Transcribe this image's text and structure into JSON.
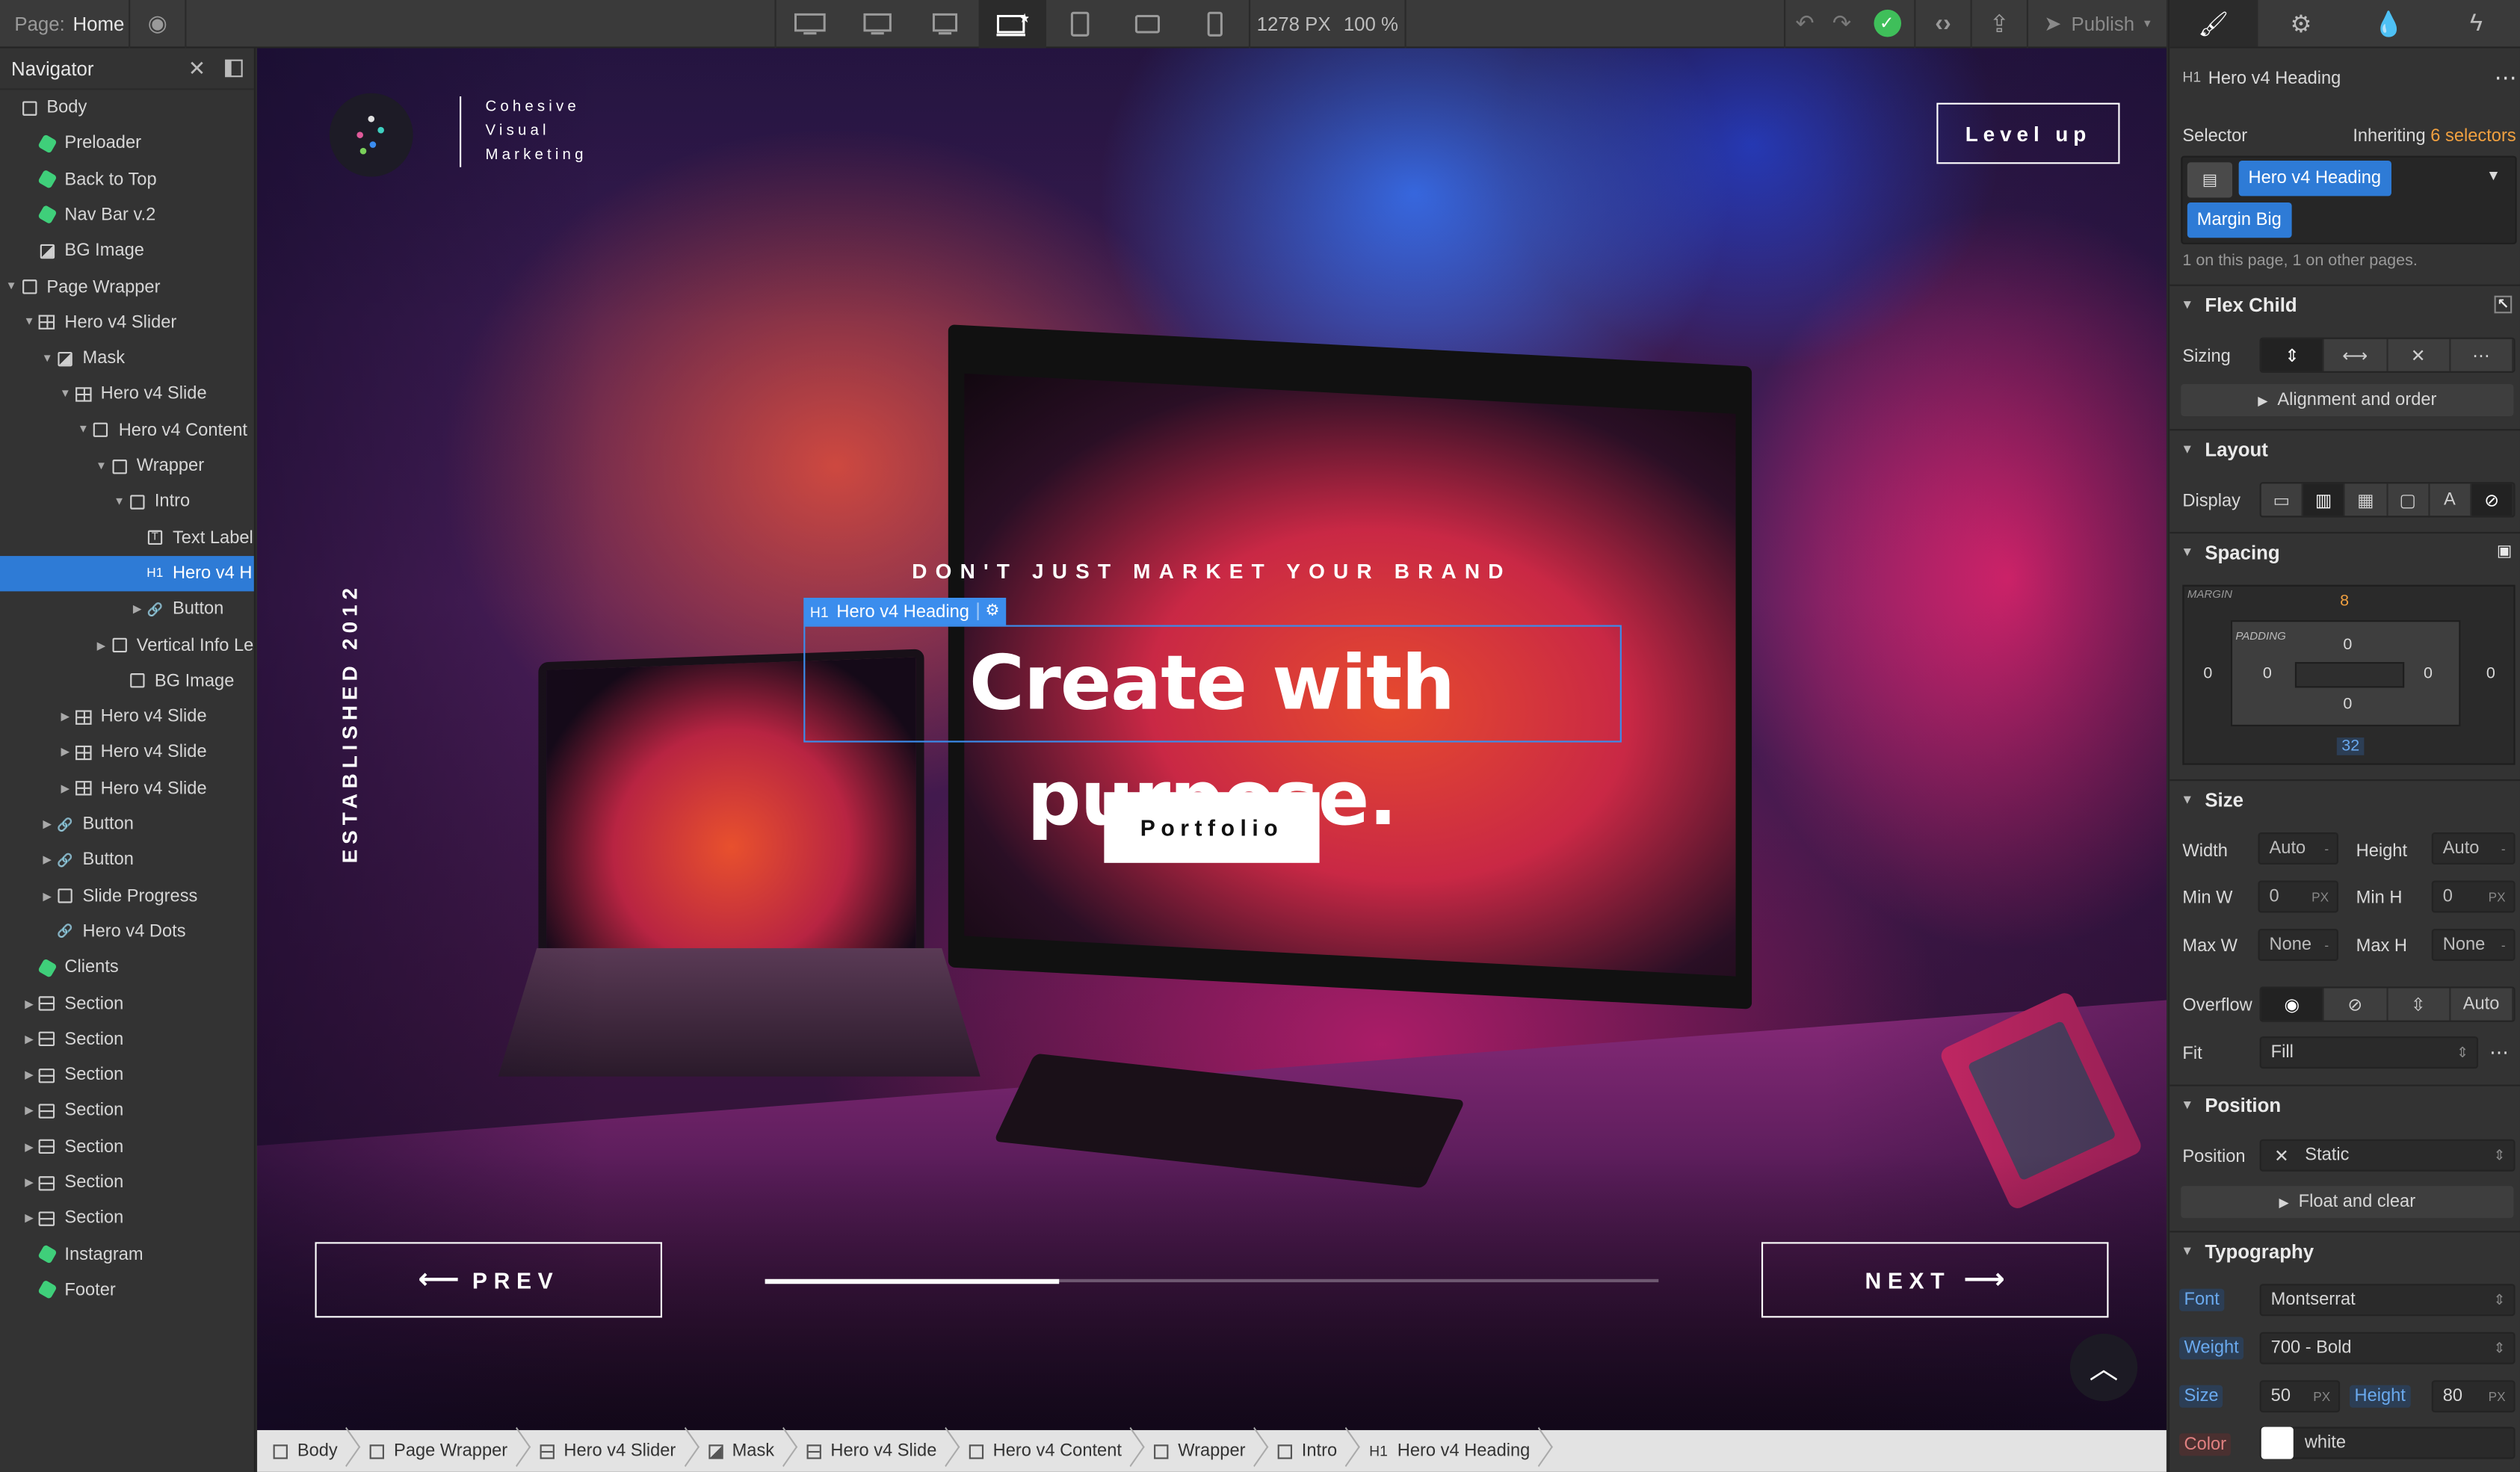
{
  "topbar": {
    "page_label": "Page:",
    "page_name": "Home",
    "width_readout": "1278 PX",
    "zoom_readout": "100 %",
    "publish_label": "Publish"
  },
  "navigator": {
    "title": "Navigator",
    "items": [
      {
        "label": "Body"
      },
      {
        "label": "Preloader"
      },
      {
        "label": "Back to Top"
      },
      {
        "label": "Nav Bar v.2"
      },
      {
        "label": "BG Image"
      },
      {
        "label": "Page Wrapper"
      },
      {
        "label": "Hero v4 Slider"
      },
      {
        "label": "Mask"
      },
      {
        "label": "Hero v4 Slide"
      },
      {
        "label": "Hero v4 Content"
      },
      {
        "label": "Wrapper"
      },
      {
        "label": "Intro"
      },
      {
        "label": "Text Label"
      },
      {
        "label": "Hero v4 H"
      },
      {
        "label": "Button"
      },
      {
        "label": "Vertical Info Le"
      },
      {
        "label": "BG Image"
      },
      {
        "label": "Hero v4 Slide"
      },
      {
        "label": "Hero v4 Slide"
      },
      {
        "label": "Hero v4 Slide"
      },
      {
        "label": "Button"
      },
      {
        "label": "Button"
      },
      {
        "label": "Slide Progress"
      },
      {
        "label": "Hero v4 Dots"
      },
      {
        "label": "Clients"
      },
      {
        "label": "Section"
      },
      {
        "label": "Section"
      },
      {
        "label": "Section"
      },
      {
        "label": "Section"
      },
      {
        "label": "Section"
      },
      {
        "label": "Section"
      },
      {
        "label": "Section"
      },
      {
        "label": "Instagram"
      },
      {
        "label": "Footer"
      }
    ],
    "h1_tag": "H1"
  },
  "site": {
    "brand_lines": [
      "Cohesive",
      "Visual",
      "Marketing"
    ],
    "level_up": "Level up",
    "established": "ESTABLISHED 2012",
    "tagline": "DON'T JUST MARKET YOUR BRAND",
    "headline": "Create with purpose.",
    "selection_tag": "Hero v4 Heading",
    "selection_tag_type": "H1",
    "portfolio_button": "Portfolio",
    "prev_button": "PREV",
    "next_button": "NEXT",
    "slide_progress_fraction": 0.33
  },
  "breadcrumb": [
    "Body",
    "Page Wrapper",
    "Hero v4 Slider",
    "Mask",
    "Hero v4 Slide",
    "Hero v4 Content",
    "Wrapper",
    "Intro",
    "Hero v4 Heading"
  ],
  "breadcrumb_last_tag": "H1",
  "panel": {
    "element_tag": "H1",
    "element_name": "Hero v4 Heading",
    "selector_label": "Selector",
    "inheriting_prefix": "Inheriting",
    "inheriting_count": "6 selectors",
    "selector_class": "Hero v4 Heading",
    "combo_class": "Margin Big",
    "usage_note": "1 on this page, 1 on other pages.",
    "flex_child": "Flex Child",
    "sizing_label": "Sizing",
    "alignment_order": "Alignment and order",
    "layout": "Layout",
    "display_label": "Display",
    "spacing": "Spacing",
    "margin_label": "MARGIN",
    "padding_label": "PADDING",
    "margin_top": "8",
    "margin_right": "0",
    "margin_bottom": "32",
    "margin_left": "0",
    "padding_top": "0",
    "padding_right": "0",
    "padding_bottom": "0",
    "padding_left": "0",
    "size": "Size",
    "width_label": "Width",
    "width_value": "Auto",
    "height_label": "Height",
    "height_value": "Auto",
    "minw_label": "Min W",
    "minw_value": "0",
    "minh_label": "Min H",
    "minh_value": "0",
    "maxw_label": "Max W",
    "maxw_value": "None",
    "maxh_label": "Max H",
    "maxh_value": "None",
    "unit_px": "PX",
    "unit_dash": "-",
    "overflow_label": "Overflow",
    "overflow_auto": "Auto",
    "fit_label": "Fit",
    "fit_value": "Fill",
    "position": "Position",
    "position_label": "Position",
    "position_value": "Static",
    "float_clear": "Float and clear",
    "typography": "Typography",
    "font_label": "Font",
    "font_value": "Montserrat",
    "weight_label": "Weight",
    "weight_value": "700 - Bold",
    "size_label": "Size",
    "size_value": "50",
    "lheight_label": "Height",
    "lheight_value": "80",
    "color_label": "Color",
    "color_value": "white"
  },
  "colors": {
    "accent": "#2e7bd6",
    "selection": "#3b8ded",
    "success": "#3fbf5a",
    "orange": "#f0a040",
    "symbol_green": "#3fcf7a"
  }
}
